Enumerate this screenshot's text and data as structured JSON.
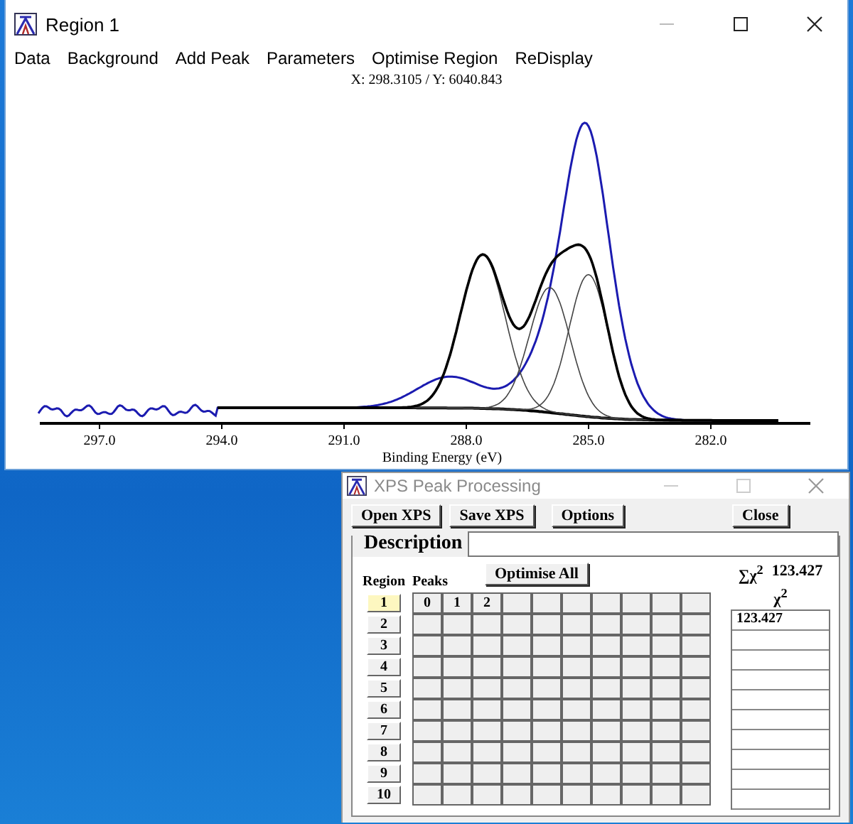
{
  "region_window": {
    "title": "Region 1",
    "menu": [
      "Data",
      "Background",
      "Add Peak",
      "Parameters",
      "Optimise Region",
      "ReDisplay"
    ],
    "cursor_readout": "X: 298.3105 / Y: 6040.843",
    "plot": {
      "x_ticks": [
        "297.0",
        "294.0",
        "291.0",
        "288.0",
        "285.0",
        "282.0"
      ],
      "xlabel": "Binding Energy (eV)"
    }
  },
  "xps_window": {
    "title": "XPS Peak Processing",
    "buttons": [
      "Open XPS",
      "Save XPS",
      "Options"
    ],
    "close_button": "Close",
    "description_label": "Description",
    "optimise_all": "Optimise All",
    "sum_chi2_label": "∑χ$^{2}$",
    "sum_chi2_value": "123.427",
    "chi2_header": "χ$^{2}$",
    "region_header": "Region",
    "peaks_header": "Peaks",
    "peak_labels": [
      "0",
      "1",
      "2"
    ],
    "regions": [
      {
        "label": "1",
        "selected": true,
        "chi2": "123.427"
      },
      {
        "label": "2",
        "selected": false
      },
      {
        "label": "3",
        "selected": false
      },
      {
        "label": "4",
        "selected": false
      },
      {
        "label": "5",
        "selected": false
      },
      {
        "label": "6",
        "selected": false
      },
      {
        "label": "7",
        "selected": false
      },
      {
        "label": "8",
        "selected": false
      },
      {
        "label": "9",
        "selected": false
      },
      {
        "label": "10",
        "selected": false
      }
    ]
  }
}
